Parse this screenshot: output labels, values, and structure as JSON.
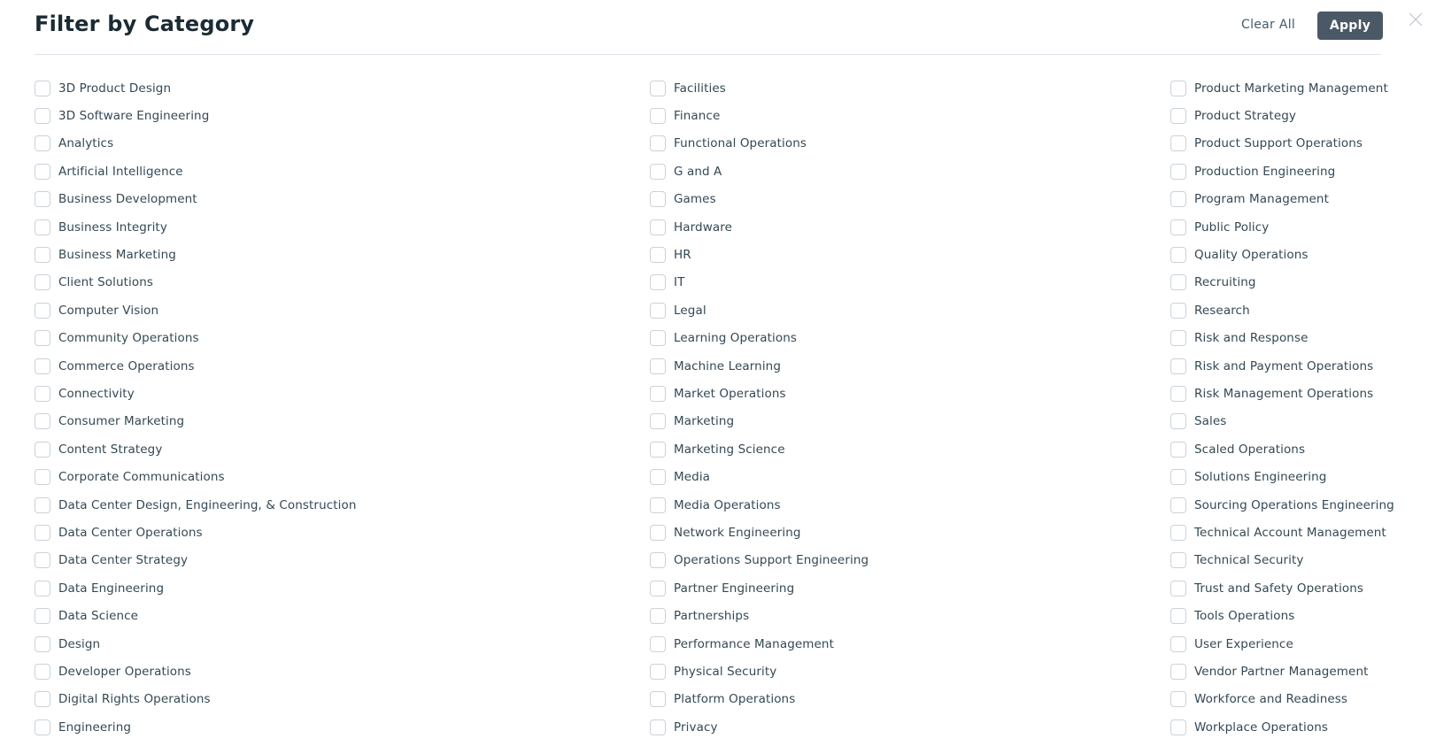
{
  "header": {
    "title": "Filter by Category",
    "clear_all_label": "Clear All",
    "apply_label": "Apply",
    "close_icon": "close-icon"
  },
  "columns": [
    {
      "items": [
        {
          "label": "3D Product Design",
          "checked": false
        },
        {
          "label": "3D Software Engineering",
          "checked": false
        },
        {
          "label": "Analytics",
          "checked": false
        },
        {
          "label": "Artificial Intelligence",
          "checked": false
        },
        {
          "label": "Business Development",
          "checked": false
        },
        {
          "label": "Business Integrity",
          "checked": false
        },
        {
          "label": "Business Marketing",
          "checked": false
        },
        {
          "label": "Client Solutions",
          "checked": false
        },
        {
          "label": "Computer Vision",
          "checked": false
        },
        {
          "label": "Community Operations",
          "checked": false
        },
        {
          "label": "Commerce Operations",
          "checked": false
        },
        {
          "label": "Connectivity",
          "checked": false
        },
        {
          "label": "Consumer Marketing",
          "checked": false
        },
        {
          "label": "Content Strategy",
          "checked": false
        },
        {
          "label": "Corporate Communications",
          "checked": false
        },
        {
          "label": "Data Center Design, Engineering, & Construction",
          "checked": false
        },
        {
          "label": "Data Center Operations",
          "checked": false
        },
        {
          "label": "Data Center Strategy",
          "checked": false
        },
        {
          "label": "Data Engineering",
          "checked": false
        },
        {
          "label": "Data Science",
          "checked": false
        },
        {
          "label": "Design",
          "checked": false
        },
        {
          "label": "Developer Operations",
          "checked": false
        },
        {
          "label": "Digital Rights Operations",
          "checked": false
        },
        {
          "label": "Engineering",
          "checked": false
        }
      ]
    },
    {
      "items": [
        {
          "label": "Facilities",
          "checked": false
        },
        {
          "label": "Finance",
          "checked": false
        },
        {
          "label": "Functional Operations",
          "checked": false
        },
        {
          "label": "G and A",
          "checked": false
        },
        {
          "label": "Games",
          "checked": false
        },
        {
          "label": "Hardware",
          "checked": false
        },
        {
          "label": "HR",
          "checked": false
        },
        {
          "label": "IT",
          "checked": false
        },
        {
          "label": "Legal",
          "checked": false
        },
        {
          "label": "Learning Operations",
          "checked": false
        },
        {
          "label": "Machine Learning",
          "checked": false
        },
        {
          "label": "Market Operations",
          "checked": false
        },
        {
          "label": "Marketing",
          "checked": false
        },
        {
          "label": "Marketing Science",
          "checked": false
        },
        {
          "label": "Media",
          "checked": false
        },
        {
          "label": "Media Operations",
          "checked": false
        },
        {
          "label": "Network Engineering",
          "checked": false
        },
        {
          "label": "Operations Support Engineering",
          "checked": false
        },
        {
          "label": "Partner Engineering",
          "checked": false
        },
        {
          "label": "Partnerships",
          "checked": false
        },
        {
          "label": "Performance Management",
          "checked": false
        },
        {
          "label": "Physical Security",
          "checked": false
        },
        {
          "label": "Platform Operations",
          "checked": false
        },
        {
          "label": "Privacy",
          "checked": false
        }
      ]
    },
    {
      "items": [
        {
          "label": "Product Marketing Management",
          "checked": false
        },
        {
          "label": "Product Strategy",
          "checked": false
        },
        {
          "label": "Product Support Operations",
          "checked": false
        },
        {
          "label": "Production Engineering",
          "checked": false
        },
        {
          "label": "Program Management",
          "checked": false
        },
        {
          "label": "Public Policy",
          "checked": false
        },
        {
          "label": "Quality Operations",
          "checked": false
        },
        {
          "label": "Recruiting",
          "checked": false
        },
        {
          "label": "Research",
          "checked": false
        },
        {
          "label": "Risk and Response",
          "checked": false
        },
        {
          "label": "Risk and Payment Operations",
          "checked": false
        },
        {
          "label": "Risk Management Operations",
          "checked": false
        },
        {
          "label": "Sales",
          "checked": false
        },
        {
          "label": "Scaled Operations",
          "checked": false
        },
        {
          "label": "Solutions Engineering",
          "checked": false
        },
        {
          "label": "Sourcing Operations Engineering",
          "checked": false
        },
        {
          "label": "Technical Account Management",
          "checked": false
        },
        {
          "label": "Technical Security",
          "checked": false
        },
        {
          "label": "Trust and Safety Operations",
          "checked": false
        },
        {
          "label": "Tools Operations",
          "checked": false
        },
        {
          "label": "User Experience",
          "checked": false
        },
        {
          "label": "Vendor Partner Management",
          "checked": false
        },
        {
          "label": "Workforce and Readiness",
          "checked": false
        },
        {
          "label": "Workplace Operations",
          "checked": false
        }
      ]
    }
  ]
}
